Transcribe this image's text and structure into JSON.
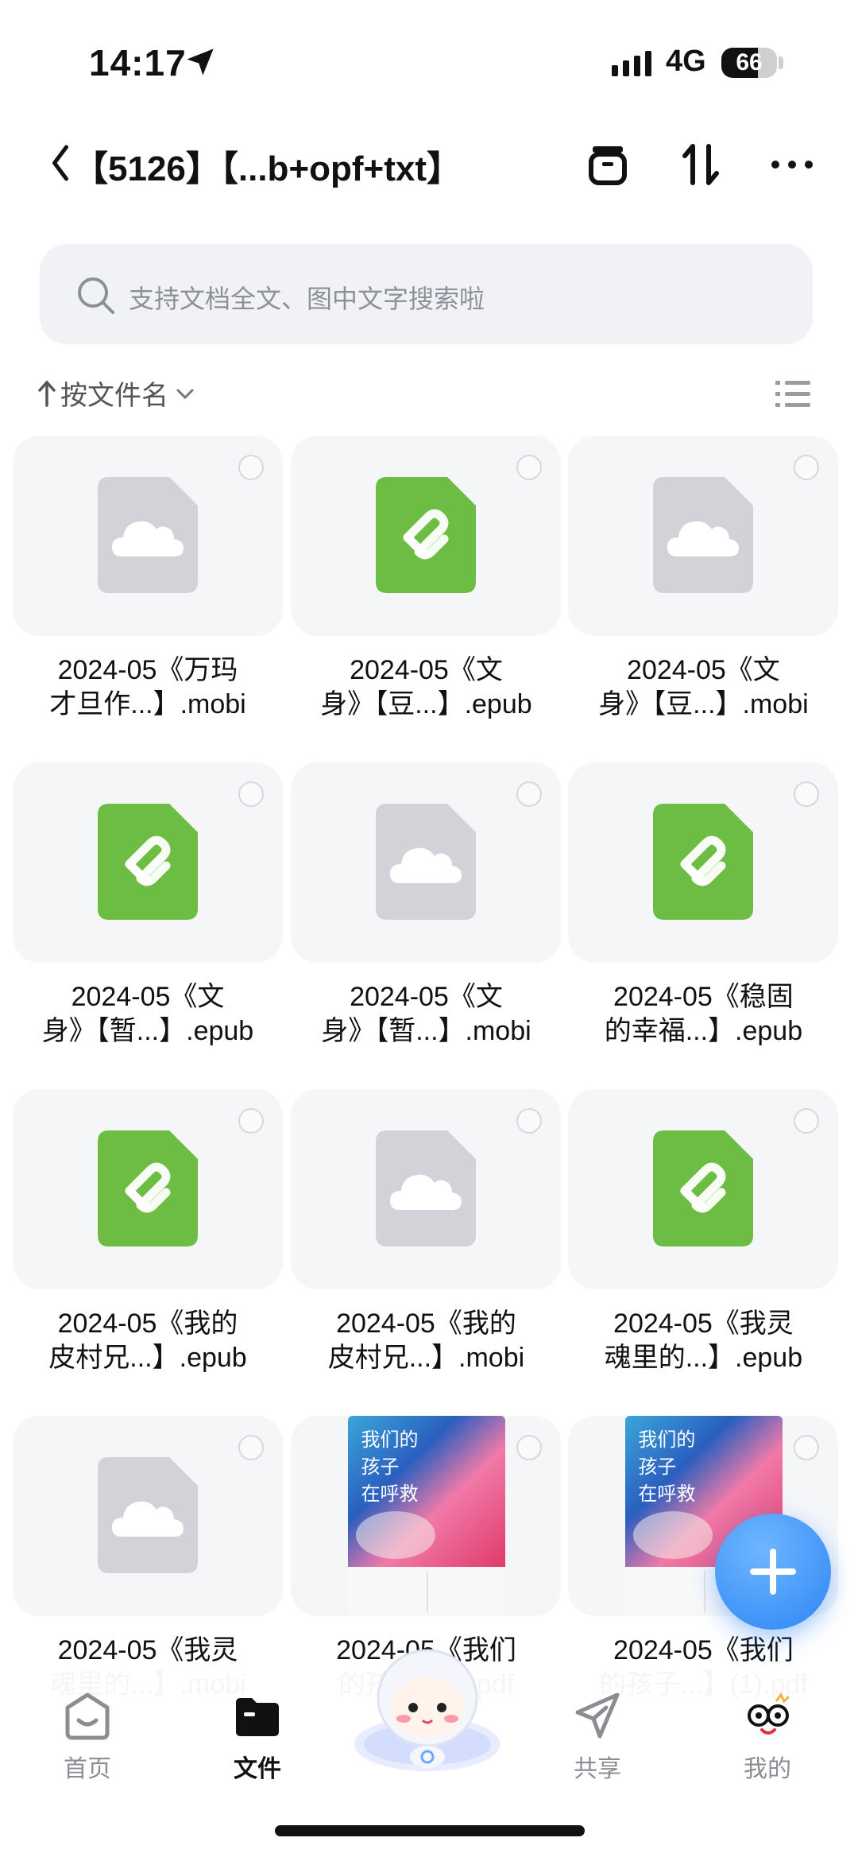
{
  "status": {
    "time": "14:17",
    "network": "4G",
    "battery": "66",
    "battery_level": 0.66
  },
  "header": {
    "title": "【5126】【...b+opf+txt】",
    "icons": [
      "chevron-left-icon",
      "archive-icon",
      "sort-arrows-icon",
      "more-icon"
    ]
  },
  "search": {
    "placeholder": "支持文档全文、图中文字搜索啦"
  },
  "sort": {
    "label": "按文件名"
  },
  "files": [
    {
      "name": "2024-05《万玛才旦作...】.mobi",
      "line1": "2024-05《万玛",
      "line2": "才旦作...】.mobi",
      "type": "mobi"
    },
    {
      "name": "2024-05《文身》【豆...】.epub",
      "line1": "2024-05《文",
      "line2": "身》【豆...】.epub",
      "type": "epub"
    },
    {
      "name": "2024-05《文身》【豆...】.mobi",
      "line1": "2024-05《文",
      "line2": "身》【豆...】.mobi",
      "type": "mobi"
    },
    {
      "name": "2024-05《文身》【暂...】.epub",
      "line1": "2024-05《文",
      "line2": "身》【暂...】.epub",
      "type": "epub"
    },
    {
      "name": "2024-05《文身》【暂...】.mobi",
      "line1": "2024-05《文",
      "line2": "身》【暂...】.mobi",
      "type": "mobi"
    },
    {
      "name": "2024-05《稳固的幸福...】.epub",
      "line1": "2024-05《稳固",
      "line2": "的幸福...】.epub",
      "type": "epub"
    },
    {
      "name": "2024-05《我的皮村兄...】.epub",
      "line1": "2024-05《我的",
      "line2": "皮村兄...】.epub",
      "type": "epub"
    },
    {
      "name": "2024-05《我的皮村兄...】.mobi",
      "line1": "2024-05《我的",
      "line2": "皮村兄...】.mobi",
      "type": "mobi"
    },
    {
      "name": "2024-05《我灵魂里的...】.epub",
      "line1": "2024-05《我灵",
      "line2": "魂里的...】.epub",
      "type": "epub"
    },
    {
      "name": "2024-05《我灵魂里的...】.mobi",
      "line1": "2024-05《我灵",
      "line2": "魂里的...】.mobi",
      "type": "mobi"
    },
    {
      "name": "2024-05《我们的孩子...】.pdf",
      "line1": "2024-05《我们",
      "line2": "的孩子...】.pdf",
      "type": "pdf",
      "cover_title": [
        "我们的",
        "孩子",
        "在呼救"
      ]
    },
    {
      "name": "2024-05《我们的孩子...】(1).pdf",
      "line1": "2024-05《我们",
      "line2": "的孩子...】(1).pdf",
      "type": "pdf",
      "cover_title": [
        "我们的",
        "孩子",
        "在呼救"
      ]
    }
  ],
  "tabs": [
    {
      "label": "首页",
      "icon": "home-icon",
      "active": false
    },
    {
      "label": "文件",
      "icon": "folder-icon",
      "active": true
    },
    {
      "label": "共享",
      "icon": "share-icon",
      "active": false
    },
    {
      "label": "我的",
      "icon": "profile-icon",
      "active": false
    }
  ],
  "colors": {
    "accent": "#2d86f5",
    "epub_green": "#6dbd45",
    "mobi_gray": "#d1d3d8"
  }
}
